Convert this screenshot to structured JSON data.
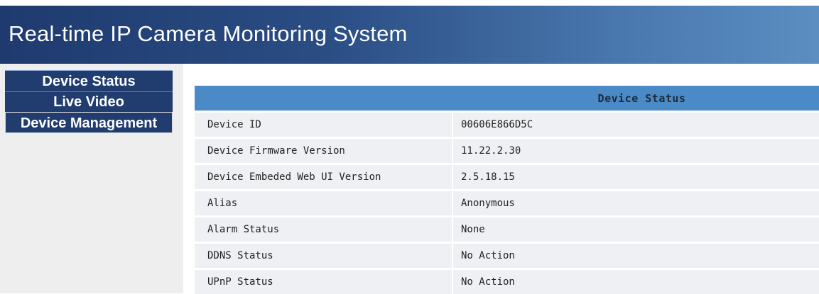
{
  "header": {
    "title": "Real-time IP Camera Monitoring System"
  },
  "sidebar": {
    "items": [
      {
        "label": "Device Status"
      },
      {
        "label": "Live Video"
      },
      {
        "label": "Device Management"
      }
    ]
  },
  "status_table": {
    "title": "Device Status",
    "rows": [
      {
        "label": "Device ID",
        "value": "00606E866D5C"
      },
      {
        "label": "Device Firmware Version",
        "value": "11.22.2.30"
      },
      {
        "label": "Device Embeded Web UI Version",
        "value": "2.5.18.15"
      },
      {
        "label": "Alias",
        "value": "Anonymous"
      },
      {
        "label": "Alarm Status",
        "value": "None"
      },
      {
        "label": "DDNS Status",
        "value": "No Action"
      },
      {
        "label": "UPnP Status",
        "value": "No Action"
      }
    ]
  },
  "colors": {
    "header_start": "#1f3a6e",
    "header_end": "#5c8ec2",
    "nav_button": "#213d70",
    "table_header": "#4a8ac7",
    "row_background": "#eef0f3"
  }
}
